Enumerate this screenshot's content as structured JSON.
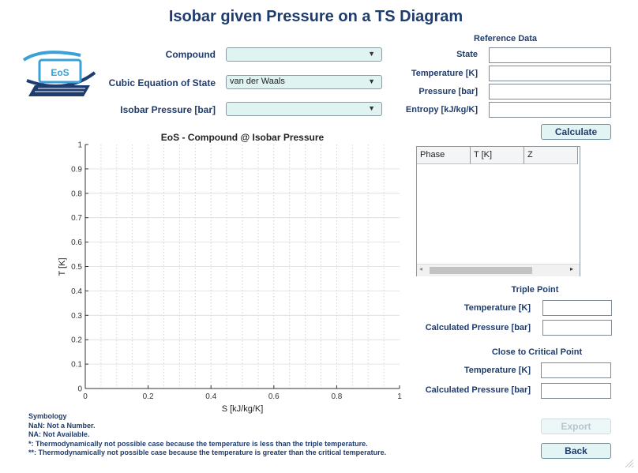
{
  "window": {
    "title": "Isobar given Pressure on a TS Diagram",
    "logo_text": "EoS"
  },
  "inputs": {
    "compound": {
      "label": "Compound",
      "value": ""
    },
    "equation": {
      "label": "Cubic Equation of State",
      "value": "van der Waals"
    },
    "pressure": {
      "label": "Isobar Pressure [bar]",
      "value": ""
    }
  },
  "reference": {
    "header": "Reference Data",
    "state_label": "State",
    "temperature_label": "Temperature [K]",
    "pressure_label": "Pressure [bar]",
    "entropy_label": "Entropy [kJ/kg/K]",
    "calculate_label": "Calculate"
  },
  "results_table": {
    "columns": [
      "Phase",
      "T [K]",
      "Z"
    ],
    "rows": []
  },
  "triple_point": {
    "header": "Triple Point",
    "temperature_label": "Temperature [K]",
    "pressure_label": "Calculated Pressure [bar]"
  },
  "critical_point": {
    "header": "Close to Critical Point",
    "temperature_label": "Temperature [K]",
    "pressure_label": "Calculated Pressure [bar]"
  },
  "buttons": {
    "export_label": "Export",
    "back_label": "Back"
  },
  "symbology": {
    "header": "Symbology",
    "lines": [
      "NaN: Not a Number.",
      "NA: Not Available.",
      "*: Thermodynamically not possible case because the temperature is less than the triple temperature.",
      "**: Thermodynamically not possible case because the temperature is greater than the critical temperature."
    ]
  },
  "colors": {
    "title": "#1f3c6e",
    "dropdown_bg": "#dff3f1",
    "button_bg": "#e3f4f5",
    "logo_blue": "#3aa0d8"
  },
  "chart_data": {
    "type": "line",
    "title": "EoS - Compound @ Isobar Pressure",
    "xlabel": "S [kJ/kg/K]",
    "ylabel": "T [K]",
    "xlim": [
      0,
      1
    ],
    "ylim": [
      0,
      1
    ],
    "xticks": [
      "0",
      "0.2",
      "0.4",
      "0.6",
      "0.8",
      "1"
    ],
    "yticks": [
      "0",
      "0.1",
      "0.2",
      "0.3",
      "0.4",
      "0.5",
      "0.6",
      "0.7",
      "0.8",
      "0.9",
      "1"
    ],
    "grid": true,
    "series": []
  }
}
